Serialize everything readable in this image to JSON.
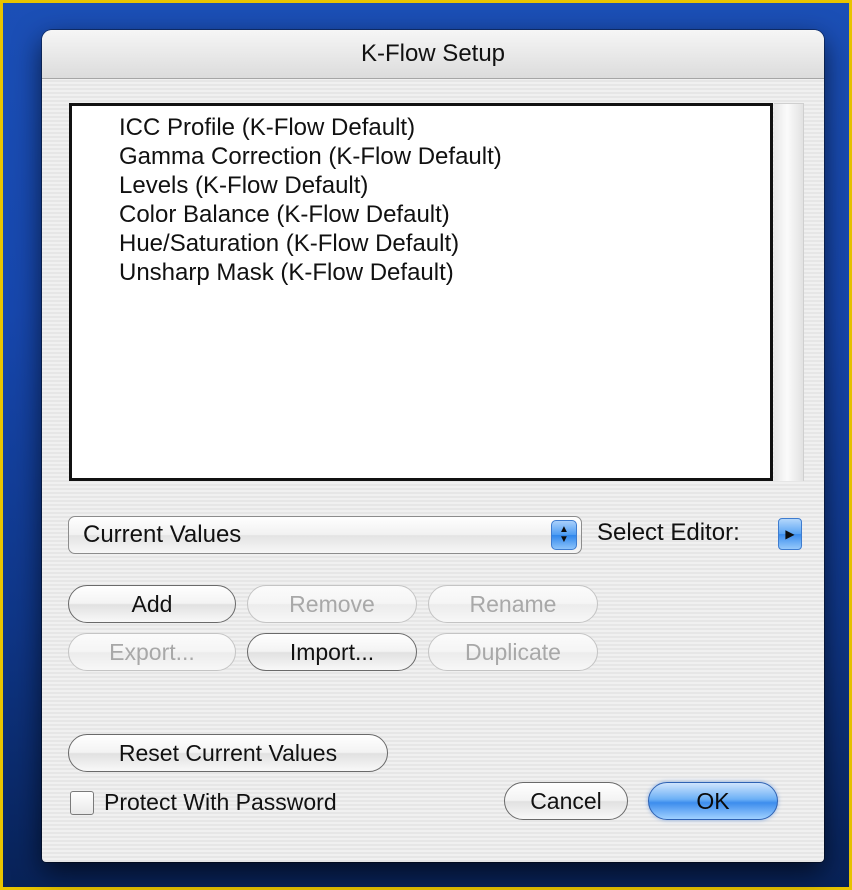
{
  "window": {
    "title": "K-Flow Setup"
  },
  "list": {
    "items": [
      "ICC Profile (K-Flow Default)",
      "Gamma Correction (K-Flow Default)",
      "Levels (K-Flow Default)",
      "Color Balance (K-Flow Default)",
      "Hue/Saturation (K-Flow Default)",
      "Unsharp Mask (K-Flow Default)"
    ]
  },
  "preset_popup": {
    "value": "Current Values",
    "icon": "up-down-arrows-icon"
  },
  "select_editor": {
    "label": "Select Editor:",
    "icon": "disclosure-triangle-icon"
  },
  "buttons": {
    "add": "Add",
    "remove": "Remove",
    "rename": "Rename",
    "export": "Export...",
    "import": "Import...",
    "duplicate": "Duplicate",
    "reset": "Reset Current Values",
    "cancel": "Cancel",
    "ok": "OK"
  },
  "protect": {
    "label": "Protect With Password",
    "checked": false
  },
  "colors": {
    "frame_border": "#e8c400",
    "desktop": "#1747ad",
    "default_button": "#3d8ded"
  }
}
